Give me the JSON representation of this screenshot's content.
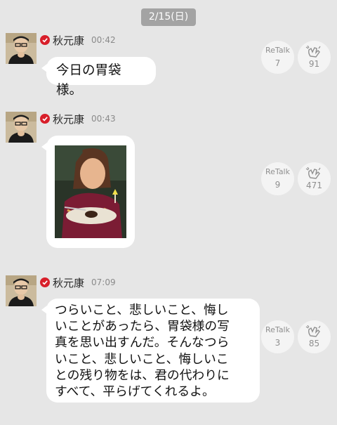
{
  "date_label": "2/15(日)",
  "messages": [
    {
      "author": "秋元康",
      "time": "00:42",
      "text": "今日の胃袋様。",
      "retalk_label": "ReTalk",
      "retalk_count": "7",
      "clap_count": "91"
    },
    {
      "author": "秋元康",
      "time": "00:43",
      "text": "",
      "retalk_label": "ReTalk",
      "retalk_count": "9",
      "clap_count": "471"
    },
    {
      "author": "秋元康",
      "time": "07:09",
      "text_lines": [
        "つらいこと、悲しいこと、悔し",
        "いことがあったら、胃袋様の写",
        "真を思い出すんだ。そんなつら",
        "いこと、悲しいこと、悔しいこ",
        "との残り物をは、君の代わりに",
        "すべて、平らげてくれるよ。"
      ],
      "retalk_label": "ReTalk",
      "retalk_count": "3",
      "clap_count": "85"
    }
  ],
  "icons": {
    "verified": "check-badge-icon",
    "clap": "clapping-hands-icon"
  },
  "colors": {
    "background": "#e6e6e6",
    "verified_badge": "#d81f2a",
    "date_pill": "#a3a3a3"
  }
}
